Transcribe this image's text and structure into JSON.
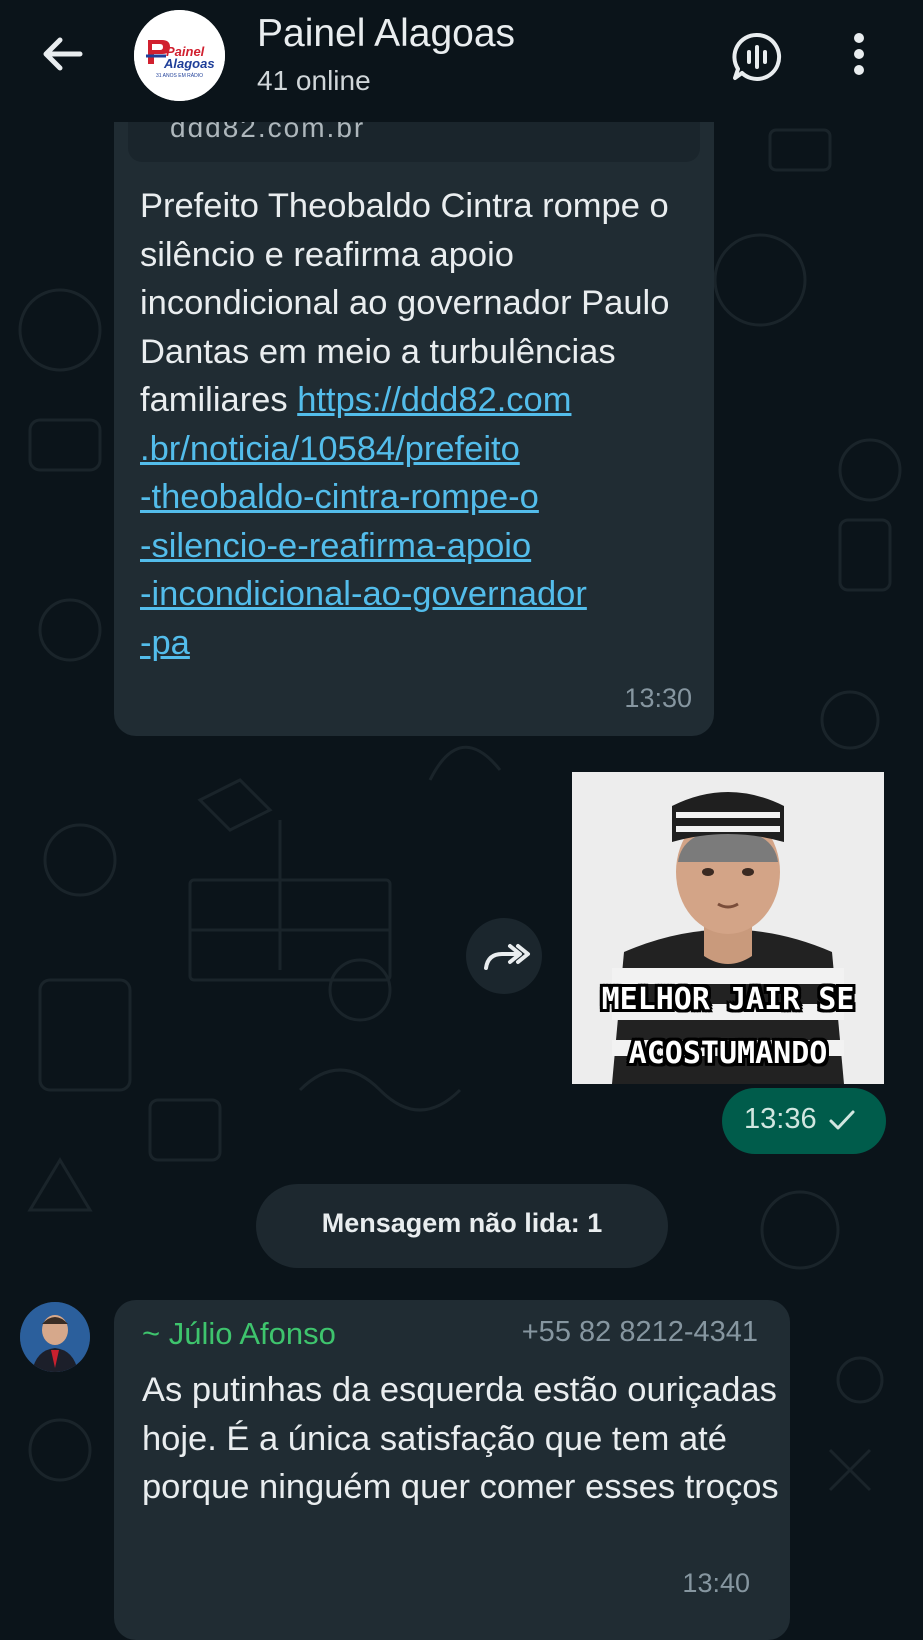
{
  "header": {
    "title": "Painel Alagoas",
    "subtitle": "41 online",
    "avatar_logo_line1": "Painel",
    "avatar_logo_line2": "Alagoas",
    "avatar_logo_tagline": "31 ANOS EM RÁDIO"
  },
  "messages": [
    {
      "type": "incoming",
      "link_preview_fragment": "ddd82.com.br",
      "text": "Prefeito Theobaldo Cintra rompe o silêncio e reafirma apoio incondicional ao governador Paulo Dantas em meio a turbulências familiares",
      "link_lines": [
        "https://ddd82.com",
        ".br/noticia/10584/prefeito",
        "-theobaldo-cintra-rompe-o",
        "-silencio-e-reafirma-apoio",
        "-incondicional-ao-governador",
        "-pa"
      ],
      "time": "13:30"
    },
    {
      "type": "outgoing-sticker",
      "sticker_caption_line1": "MELHOR JAIR SE",
      "sticker_caption_line2": "ACOSTUMANDO",
      "time": "13:36"
    },
    {
      "type": "unread-divider",
      "text": "Mensagem não lida: 1"
    },
    {
      "type": "incoming",
      "sender_name": "~ Júlio Afonso",
      "sender_phone": "+55 82 8212-4341",
      "text": "As putinhas da esquerda estão ouriçadas hoje. É a única satisfação que tem até porque ninguém quer comer esses troços",
      "time": "13:40"
    }
  ],
  "colors": {
    "background": "#0b141a",
    "incoming_bubble": "#202c33",
    "outgoing_bubble": "#005c4b",
    "link": "#53bdeb",
    "sender_name": "#3ec46d",
    "meta_text": "#8696a0"
  },
  "icons": [
    "back-arrow-icon",
    "voice-chat-icon",
    "more-options-icon",
    "forward-icon",
    "single-check-icon"
  ]
}
